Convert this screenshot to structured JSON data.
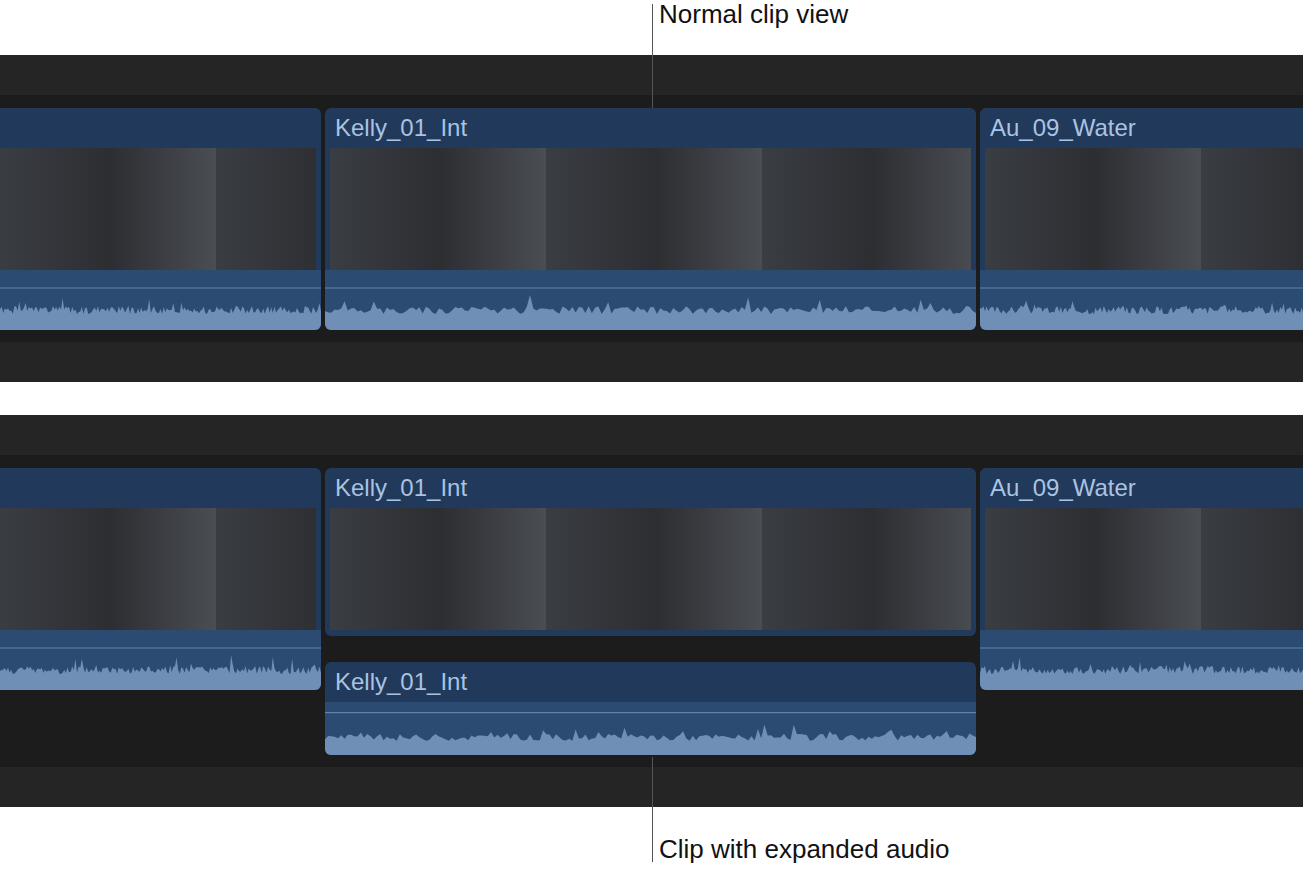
{
  "callouts": {
    "top": "Normal clip view",
    "bottom": "Clip with expanded audio"
  },
  "timelines": [
    {
      "clips": [
        {
          "name": "",
          "expanded": false
        },
        {
          "name": "Kelly_01_Int",
          "expanded": false
        },
        {
          "name": "Au_09_Water",
          "expanded": false
        }
      ]
    },
    {
      "clips": [
        {
          "name": "",
          "expanded": false
        },
        {
          "name": "Kelly_01_Int",
          "expanded": true,
          "audio_name": "Kelly_01_Int"
        },
        {
          "name": "Au_09_Water",
          "expanded": false
        }
      ]
    }
  ]
}
